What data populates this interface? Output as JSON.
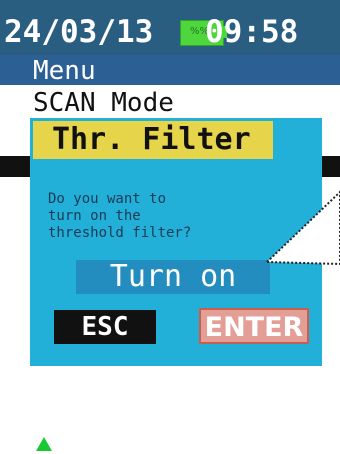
{
  "status_bar": {
    "date": "24/03/13",
    "time": "09:58",
    "battery_icon": "battery-icon",
    "battery_label": "%%"
  },
  "menu": {
    "title": "Menu",
    "current_mode": "SCAN Mode"
  },
  "dialog": {
    "title": "Thr. Filter",
    "question": "Do you want to\nturn on the\nthreshold filter?",
    "option_label": "Turn on",
    "esc_label": "ESC",
    "enter_label": "ENTER"
  },
  "colors": {
    "status_bg": "#2a5e80",
    "menu_bg": "#2c5f93",
    "dialog_bg": "#22b0d8",
    "title_bg": "#e6d44a",
    "enter_bg": "#e39f95",
    "battery": "#4fd63f"
  },
  "icons": {
    "scroll": "up-arrow-icon",
    "callout": "pointer-callout-icon"
  }
}
